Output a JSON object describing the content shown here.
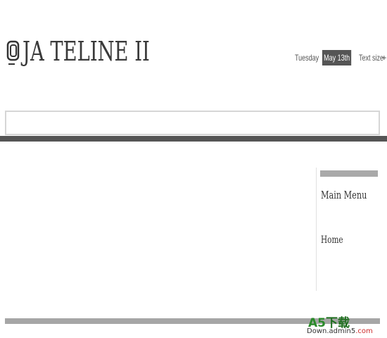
{
  "header": {
    "logo_text": "JA TELINE II",
    "logo_icon": "rounded-square-logo-icon"
  },
  "toolbar": {
    "day": "Tuesday",
    "date": "May 13th",
    "text_size_label": "Text size",
    "increase": "+",
    "reset": "x",
    "decrease": "-"
  },
  "sidebar": {
    "title": "Main Menu",
    "items": [
      {
        "label": "Home"
      }
    ]
  },
  "watermark": {
    "brand": "A5",
    "brand_cn": "下载",
    "domain_prefix": "Down.admin5",
    "domain_suffix": ".com"
  },
  "colors": {
    "dark_rule": "#555555",
    "light_rule": "#a6a6a6",
    "date_badge_bg": "#555555",
    "watermark_green": "#2a8a2a",
    "watermark_red": "#cc2a2a"
  }
}
